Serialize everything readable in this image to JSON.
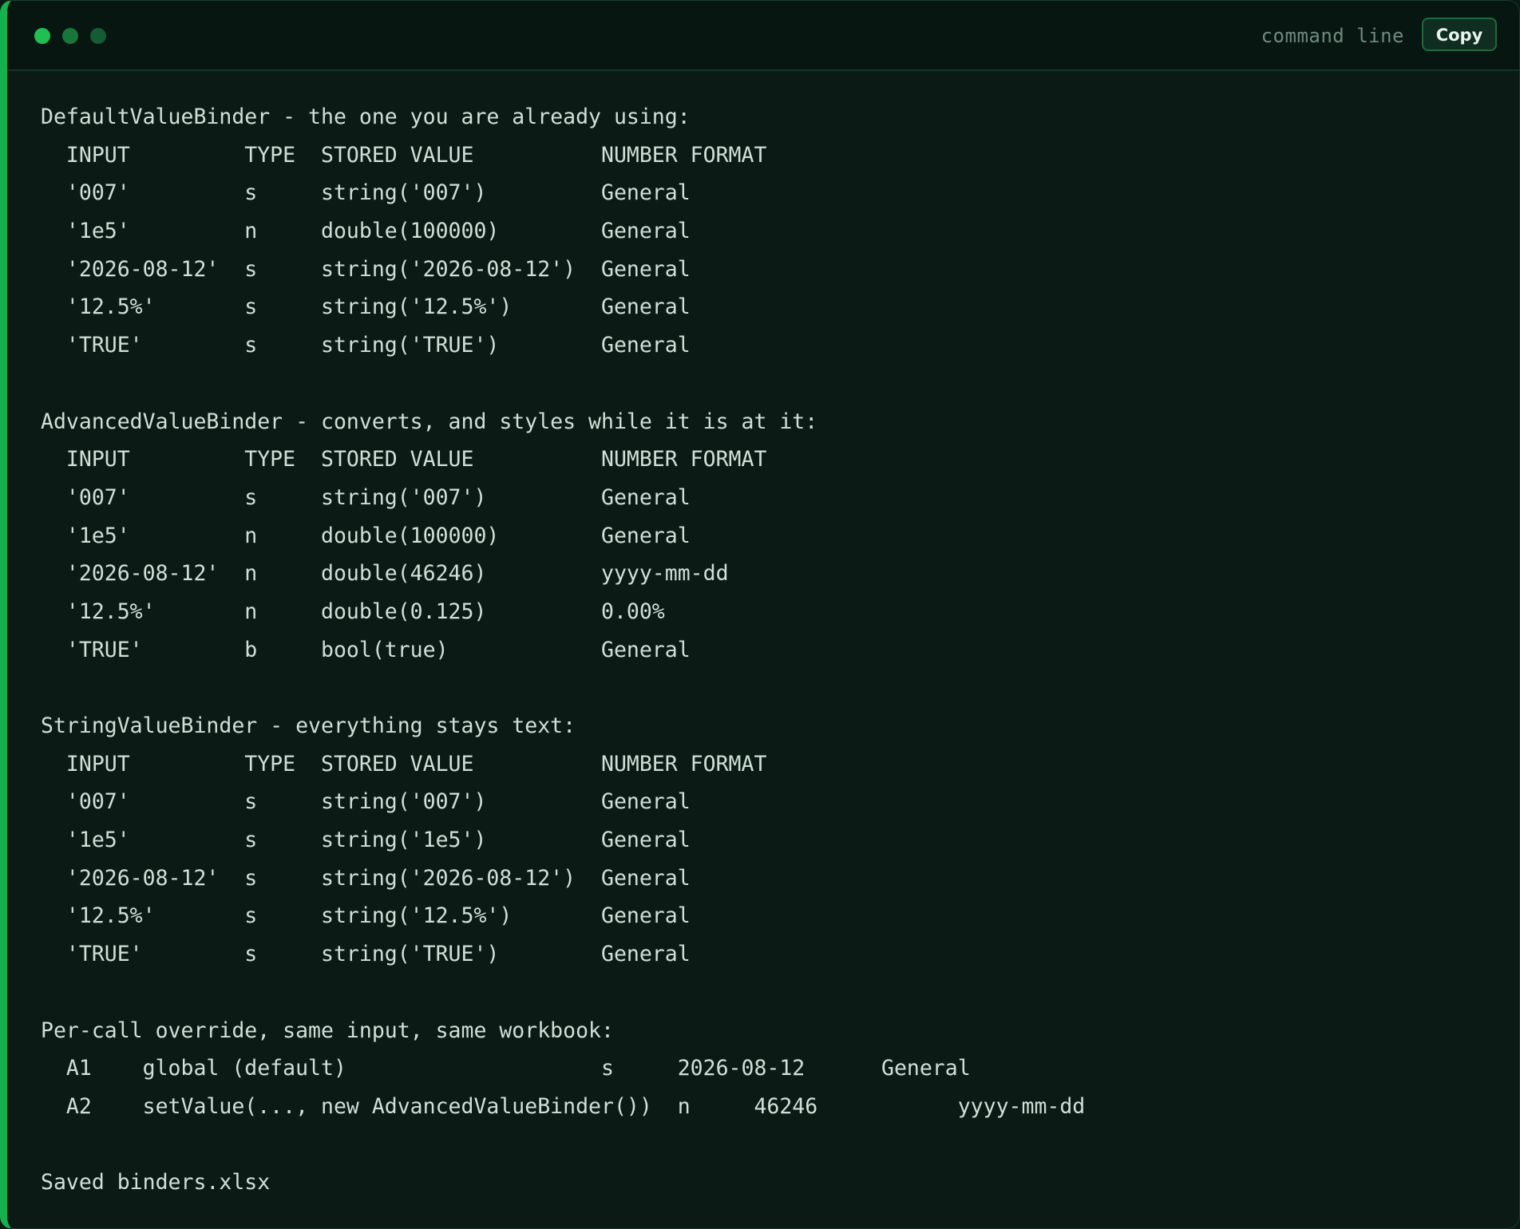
{
  "window": {
    "label": "command line",
    "copy_label": "Copy"
  },
  "output_lines": [
    "DefaultValueBinder - the one you are already using:",
    "  INPUT         TYPE  STORED VALUE          NUMBER FORMAT",
    "  '007'         s     string('007')         General",
    "  '1e5'         n     double(100000)        General",
    "  '2026-08-12'  s     string('2026-08-12')  General",
    "  '12.5%'       s     string('12.5%')       General",
    "  'TRUE'        s     string('TRUE')        General",
    "",
    "AdvancedValueBinder - converts, and styles while it is at it:",
    "  INPUT         TYPE  STORED VALUE          NUMBER FORMAT",
    "  '007'         s     string('007')         General",
    "  '1e5'         n     double(100000)        General",
    "  '2026-08-12'  n     double(46246)         yyyy-mm-dd",
    "  '12.5%'       n     double(0.125)         0.00%",
    "  'TRUE'        b     bool(true)            General",
    "",
    "StringValueBinder - everything stays text:",
    "  INPUT         TYPE  STORED VALUE          NUMBER FORMAT",
    "  '007'         s     string('007')         General",
    "  '1e5'         s     string('1e5')         General",
    "  '2026-08-12'  s     string('2026-08-12')  General",
    "  '12.5%'       s     string('12.5%')       General",
    "  'TRUE'        s     string('TRUE')        General",
    "",
    "Per-call override, same input, same workbook:",
    "  A1    global (default)                    s     2026-08-12      General",
    "  A2    setValue(..., new AdvancedValueBinder())  n     46246           yyyy-mm-dd",
    "",
    "Saved binders.xlsx"
  ]
}
